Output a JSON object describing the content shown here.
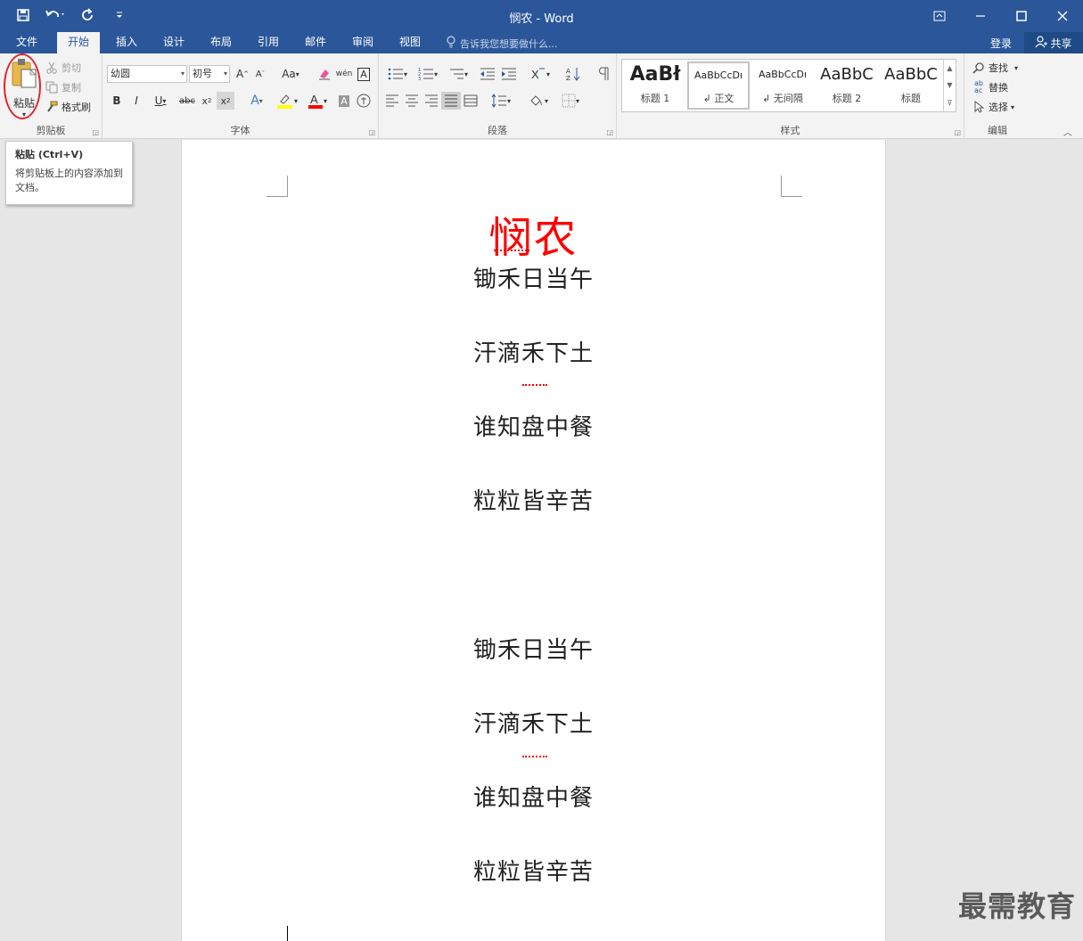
{
  "titlebar": {
    "title": "悯农 - Word",
    "qat": {
      "save_icon": "save-icon",
      "undo_icon": "undo-icon",
      "redo_icon": "redo-icon",
      "customize_icon": "customize-icon"
    },
    "controls": {
      "ribbon_display": "ribbon-display-icon",
      "minimize": "minimize-icon",
      "maximize": "maximize-icon",
      "close": "close-icon"
    }
  },
  "tabs": [
    {
      "label": "文件"
    },
    {
      "label": "开始"
    },
    {
      "label": "插入"
    },
    {
      "label": "设计"
    },
    {
      "label": "布局"
    },
    {
      "label": "引用"
    },
    {
      "label": "邮件"
    },
    {
      "label": "审阅"
    },
    {
      "label": "视图"
    }
  ],
  "tellme": "告诉我您想要做什么...",
  "account": {
    "login": "登录",
    "share": "共享"
  },
  "ribbon": {
    "clipboard": {
      "label": "剪贴板",
      "paste": "粘贴",
      "cut": "剪切",
      "copy": "复制",
      "format_painter": "格式刷"
    },
    "font": {
      "label": "字体",
      "font_name": "幼圆",
      "font_size": "初号",
      "change_case": "Aa"
    },
    "paragraph": {
      "label": "段落"
    },
    "styles": {
      "label": "样式",
      "items": [
        {
          "sample": "AaBł",
          "name": "标题 1"
        },
        {
          "sample": "AaBbCcDı",
          "name": "↲ 正文"
        },
        {
          "sample": "AaBbCcDı",
          "name": "↲ 无间隔"
        },
        {
          "sample": "AaBbC",
          "name": "标题 2"
        },
        {
          "sample": "AaBbC",
          "name": "标题"
        }
      ]
    },
    "editing": {
      "label": "编辑",
      "find": "查找",
      "replace": "替换",
      "select": "选择"
    }
  },
  "tooltip": {
    "title": "粘贴 (Ctrl+V)",
    "description": "将剪贴板上的内容添加到文档。"
  },
  "document": {
    "title": "悯农",
    "lines": [
      "锄禾日当午",
      "汗滴禾下土",
      "谁知盘中餐",
      "粒粒皆辛苦",
      "锄禾日当午",
      "汗滴禾下土",
      "谁知盘中餐",
      "粒粒皆辛苦"
    ]
  },
  "watermark": "最需教育",
  "colors": {
    "brand": "#2b579a",
    "title_red": "#ff0000",
    "annotation": "#e2262d"
  }
}
